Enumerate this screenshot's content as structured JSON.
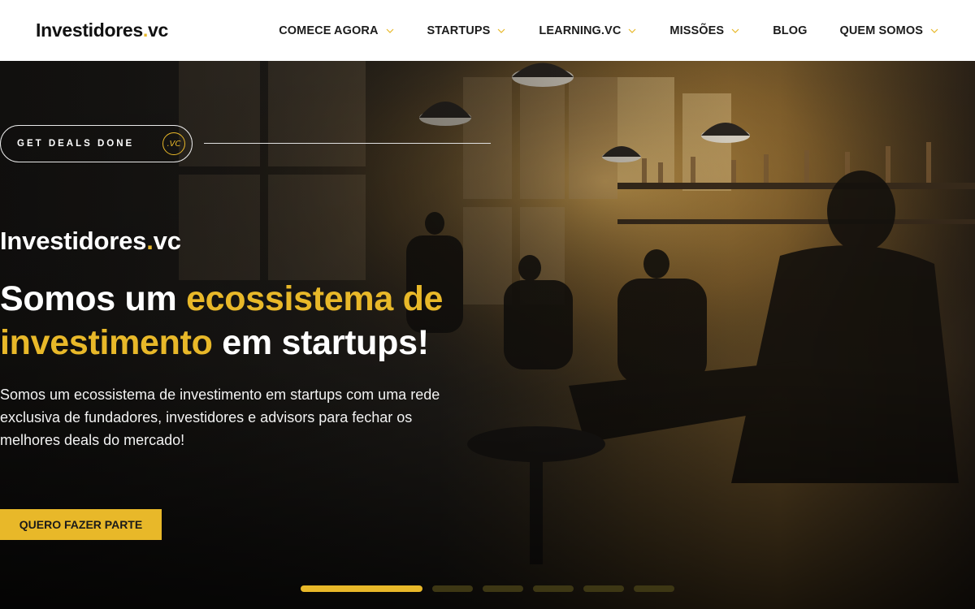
{
  "header": {
    "logo_main": "Investidores",
    "logo_dot": ".",
    "logo_suffix": "vc",
    "nav": [
      {
        "label": "COMECE AGORA",
        "has_dropdown": true
      },
      {
        "label": "STARTUPS",
        "has_dropdown": true
      },
      {
        "label": "LEARNING.VC",
        "has_dropdown": true
      },
      {
        "label": "MISSÕES",
        "has_dropdown": true
      },
      {
        "label": "BLOG",
        "has_dropdown": false
      },
      {
        "label": "QUEM SOMOS",
        "has_dropdown": true
      }
    ]
  },
  "hero": {
    "pill_text": "GET DEALS DONE",
    "pill_badge": ".VC",
    "brand_main": "Investidores",
    "brand_dot": ".",
    "brand_suffix": "vc",
    "headline_part1": "Somos um ",
    "headline_highlight_1": "ecossistema de",
    "headline_highlight_2": "investimento",
    "headline_part2": " em startups!",
    "subtext": "Somos um ecossistema de investimento em startups com uma rede exclusiva de fundadores, investidores e advisors para fechar os melhores deals do mercado!",
    "cta_label": "QUERO FAZER PARTE",
    "slides_total": 6,
    "active_slide": 1
  },
  "colors": {
    "accent": "#e8b829",
    "header_bg": "#ffffff",
    "hero_text": "#ffffff",
    "inactive_indicator": "#3d3714"
  }
}
